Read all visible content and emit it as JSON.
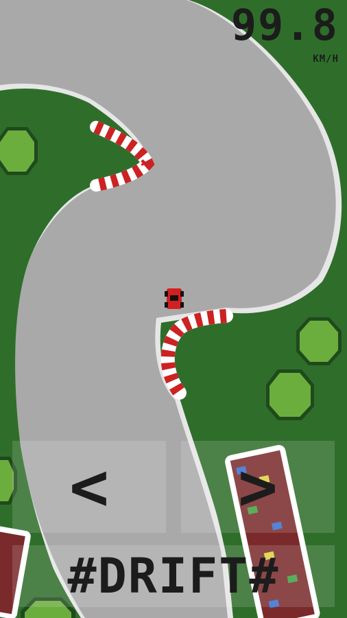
{
  "hud": {
    "speed": "99.8",
    "unit": "KM/H"
  },
  "controls": {
    "left": "<",
    "right": ">",
    "drift": "#DRIFT#"
  }
}
